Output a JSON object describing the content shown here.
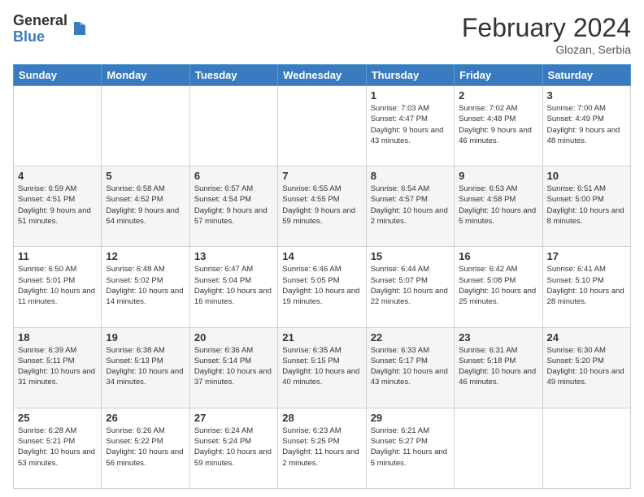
{
  "logo": {
    "general": "General",
    "blue": "Blue"
  },
  "header": {
    "month": "February 2024",
    "location": "Glozan, Serbia"
  },
  "days_of_week": [
    "Sunday",
    "Monday",
    "Tuesday",
    "Wednesday",
    "Thursday",
    "Friday",
    "Saturday"
  ],
  "weeks": [
    [
      {
        "num": "",
        "info": ""
      },
      {
        "num": "",
        "info": ""
      },
      {
        "num": "",
        "info": ""
      },
      {
        "num": "",
        "info": ""
      },
      {
        "num": "1",
        "info": "Sunrise: 7:03 AM\nSunset: 4:47 PM\nDaylight: 9 hours and 43 minutes."
      },
      {
        "num": "2",
        "info": "Sunrise: 7:02 AM\nSunset: 4:48 PM\nDaylight: 9 hours and 46 minutes."
      },
      {
        "num": "3",
        "info": "Sunrise: 7:00 AM\nSunset: 4:49 PM\nDaylight: 9 hours and 48 minutes."
      }
    ],
    [
      {
        "num": "4",
        "info": "Sunrise: 6:59 AM\nSunset: 4:51 PM\nDaylight: 9 hours and 51 minutes."
      },
      {
        "num": "5",
        "info": "Sunrise: 6:58 AM\nSunset: 4:52 PM\nDaylight: 9 hours and 54 minutes."
      },
      {
        "num": "6",
        "info": "Sunrise: 6:57 AM\nSunset: 4:54 PM\nDaylight: 9 hours and 57 minutes."
      },
      {
        "num": "7",
        "info": "Sunrise: 6:55 AM\nSunset: 4:55 PM\nDaylight: 9 hours and 59 minutes."
      },
      {
        "num": "8",
        "info": "Sunrise: 6:54 AM\nSunset: 4:57 PM\nDaylight: 10 hours and 2 minutes."
      },
      {
        "num": "9",
        "info": "Sunrise: 6:53 AM\nSunset: 4:58 PM\nDaylight: 10 hours and 5 minutes."
      },
      {
        "num": "10",
        "info": "Sunrise: 6:51 AM\nSunset: 5:00 PM\nDaylight: 10 hours and 8 minutes."
      }
    ],
    [
      {
        "num": "11",
        "info": "Sunrise: 6:50 AM\nSunset: 5:01 PM\nDaylight: 10 hours and 11 minutes."
      },
      {
        "num": "12",
        "info": "Sunrise: 6:48 AM\nSunset: 5:02 PM\nDaylight: 10 hours and 14 minutes."
      },
      {
        "num": "13",
        "info": "Sunrise: 6:47 AM\nSunset: 5:04 PM\nDaylight: 10 hours and 16 minutes."
      },
      {
        "num": "14",
        "info": "Sunrise: 6:46 AM\nSunset: 5:05 PM\nDaylight: 10 hours and 19 minutes."
      },
      {
        "num": "15",
        "info": "Sunrise: 6:44 AM\nSunset: 5:07 PM\nDaylight: 10 hours and 22 minutes."
      },
      {
        "num": "16",
        "info": "Sunrise: 6:42 AM\nSunset: 5:08 PM\nDaylight: 10 hours and 25 minutes."
      },
      {
        "num": "17",
        "info": "Sunrise: 6:41 AM\nSunset: 5:10 PM\nDaylight: 10 hours and 28 minutes."
      }
    ],
    [
      {
        "num": "18",
        "info": "Sunrise: 6:39 AM\nSunset: 5:11 PM\nDaylight: 10 hours and 31 minutes."
      },
      {
        "num": "19",
        "info": "Sunrise: 6:38 AM\nSunset: 5:13 PM\nDaylight: 10 hours and 34 minutes."
      },
      {
        "num": "20",
        "info": "Sunrise: 6:36 AM\nSunset: 5:14 PM\nDaylight: 10 hours and 37 minutes."
      },
      {
        "num": "21",
        "info": "Sunrise: 6:35 AM\nSunset: 5:15 PM\nDaylight: 10 hours and 40 minutes."
      },
      {
        "num": "22",
        "info": "Sunrise: 6:33 AM\nSunset: 5:17 PM\nDaylight: 10 hours and 43 minutes."
      },
      {
        "num": "23",
        "info": "Sunrise: 6:31 AM\nSunset: 5:18 PM\nDaylight: 10 hours and 46 minutes."
      },
      {
        "num": "24",
        "info": "Sunrise: 6:30 AM\nSunset: 5:20 PM\nDaylight: 10 hours and 49 minutes."
      }
    ],
    [
      {
        "num": "25",
        "info": "Sunrise: 6:28 AM\nSunset: 5:21 PM\nDaylight: 10 hours and 53 minutes."
      },
      {
        "num": "26",
        "info": "Sunrise: 6:26 AM\nSunset: 5:22 PM\nDaylight: 10 hours and 56 minutes."
      },
      {
        "num": "27",
        "info": "Sunrise: 6:24 AM\nSunset: 5:24 PM\nDaylight: 10 hours and 59 minutes."
      },
      {
        "num": "28",
        "info": "Sunrise: 6:23 AM\nSunset: 5:25 PM\nDaylight: 11 hours and 2 minutes."
      },
      {
        "num": "29",
        "info": "Sunrise: 6:21 AM\nSunset: 5:27 PM\nDaylight: 11 hours and 5 minutes."
      },
      {
        "num": "",
        "info": ""
      },
      {
        "num": "",
        "info": ""
      }
    ]
  ]
}
